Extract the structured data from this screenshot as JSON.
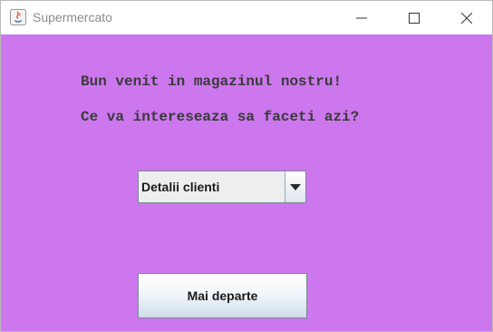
{
  "window": {
    "title": "Supermercato",
    "controls": {
      "minimize_icon": "minimize-icon",
      "maximize_icon": "maximize-icon",
      "close_icon": "close-icon"
    },
    "app_icon": "java-icon"
  },
  "main": {
    "welcome_line1": "Bun venit in magazinul nostru!",
    "welcome_line2": "Ce va intereseaza sa faceti azi?",
    "action_select": {
      "selected": "Detalii clienti",
      "arrow_icon": "chevron-down-icon"
    },
    "next_button_label": "Mai departe"
  },
  "colors": {
    "background": "#cc77ee",
    "text": "#3a3a3a",
    "titlebar": "#ffffff"
  }
}
